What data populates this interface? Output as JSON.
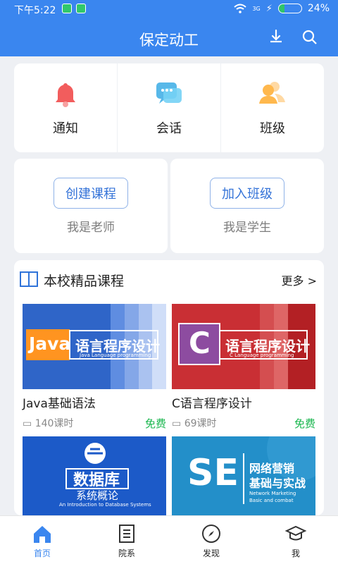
{
  "status": {
    "time": "下午5:22",
    "battery": "24%",
    "battery_level": 0.24,
    "signal": "3G"
  },
  "header": {
    "title": "保定动工",
    "download_icon": "download-icon",
    "search_icon": "search-icon"
  },
  "quick_actions": [
    {
      "label": "通知",
      "icon": "bell-icon"
    },
    {
      "label": "会话",
      "icon": "chat-icon"
    },
    {
      "label": "班级",
      "icon": "class-icon"
    }
  ],
  "roles": [
    {
      "button": "创建课程",
      "subtitle": "我是老师"
    },
    {
      "button": "加入班级",
      "subtitle": "我是学生"
    }
  ],
  "featured": {
    "title": "本校精品课程",
    "more": "更多 >",
    "courses": [
      {
        "banner_main": "Java",
        "banner_title": "语言程序设计",
        "banner_subtitle": "Java Language programming",
        "title": "Java基础语法",
        "count": "140课时",
        "price": "免费"
      },
      {
        "banner_main": "C",
        "banner_title": "语言程序设计",
        "banner_subtitle": "C Language programming",
        "title": "C语言程序设计",
        "count": "69课时",
        "price": "免费"
      }
    ],
    "preview": [
      {
        "title": "数据库",
        "subtitle": "系统概论",
        "english": "An Introduction to Database Systems"
      },
      {
        "title": "SE",
        "subtitle": "网络营销",
        "subtitle2": "基础与实战",
        "english": "Network Marketing",
        "english2": "Basic and combat"
      }
    ]
  },
  "nav": [
    {
      "label": "首页",
      "icon": "home-icon"
    },
    {
      "label": "院系",
      "icon": "department-icon"
    },
    {
      "label": "发现",
      "icon": "compass-icon"
    },
    {
      "label": "我",
      "icon": "profile-icon"
    }
  ],
  "colors": {
    "primary": "#3a86ef",
    "free": "#18b64d",
    "background": "#eef0f4"
  }
}
